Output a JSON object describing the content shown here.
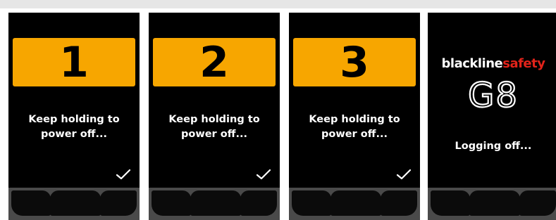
{
  "screens": [
    {
      "countdown": "1",
      "message_line1": "Keep holding to",
      "message_line2": "power off...",
      "check_icon": "checkmark-icon"
    },
    {
      "countdown": "2",
      "message_line1": "Keep holding to",
      "message_line2": "power off...",
      "check_icon": "checkmark-icon"
    },
    {
      "countdown": "3",
      "message_line1": "Keep holding to",
      "message_line2": "power off...",
      "check_icon": "checkmark-icon"
    }
  ],
  "final_screen": {
    "brand_black": "blackline",
    "brand_red": "safety",
    "model": "G8",
    "status": "Logging off..."
  },
  "colors": {
    "screen_bg": "#000000",
    "countdown_banner": "#f7a600",
    "brand_red": "#e2231a",
    "softkey_bar": "#4a4a4a",
    "softkey": "#0b0b0b"
  }
}
